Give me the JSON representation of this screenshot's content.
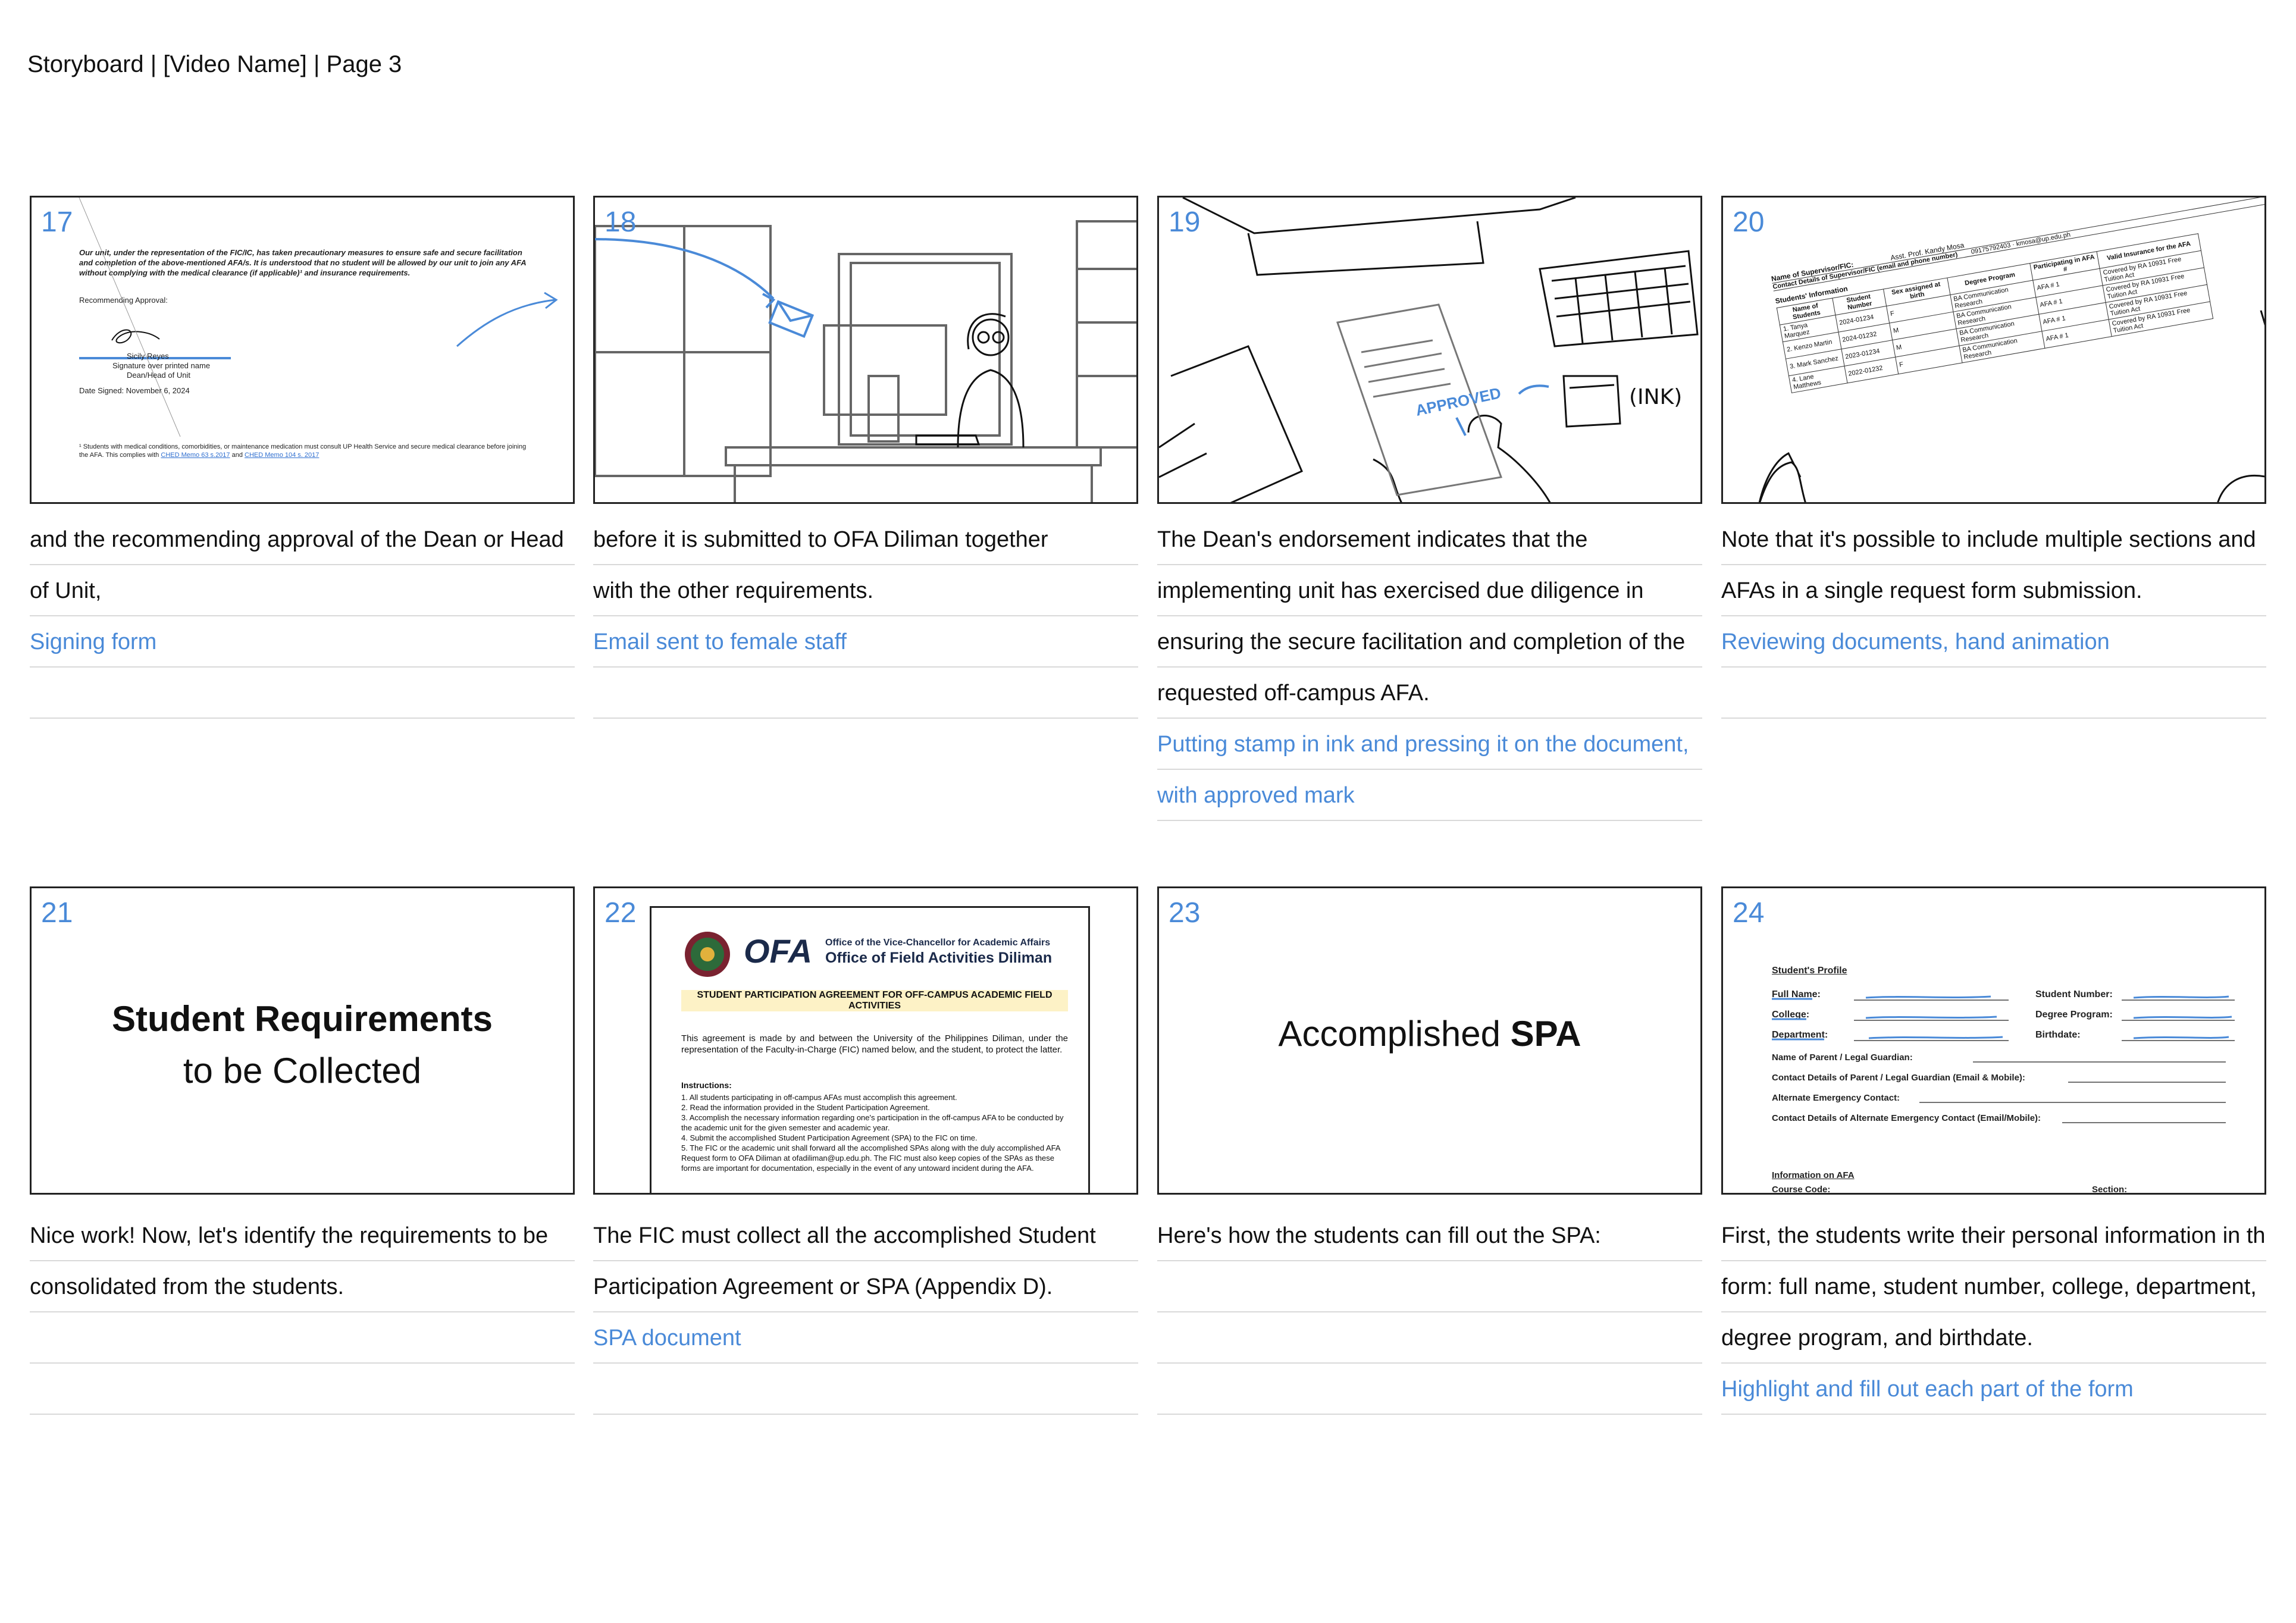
{
  "header": {
    "title": "Storyboard | [Video Name] | Page 3"
  },
  "colors": {
    "accent": "#4a8ad8",
    "border": "#222222",
    "rule": "#d9d9d9",
    "highlight": "#fdf2c6"
  },
  "frames": [
    {
      "number": "17",
      "doc": {
        "paragraph": "Our unit, under the representation of the FIC/IC, has taken precautionary measures to ensure safe and secure facilitation and completion of the above-mentioned AFA/s. It is understood that no student will be allowed by our unit to join any AFA without complying with the medical clearance (if applicable)¹ and insurance requirements.",
        "recommending": "Recommending Approval:",
        "signer_name": "Sicily Reyes",
        "signer_caption": "Signature over printed name",
        "signer_role": "Dean/Head of Unit",
        "date_signed": "Date Signed: November 6, 2024",
        "footnote": "¹ Students with medical conditions, comorbidities, or maintenance medication must consult UP Health Service and secure medical clearance before joining the AFA. This complies with",
        "link_1": "CHED Memo 63 s.2017",
        "link_join": "and",
        "link_2": "CHED Memo 104 s. 2017"
      },
      "notes": [
        "and the recommending approval of the Dean or Head",
        "of Unit,"
      ],
      "action": [
        "Signing form"
      ]
    },
    {
      "number": "18",
      "notes": [
        "before it is submitted to OFA Diliman together",
        "with the other requirements."
      ],
      "action": [
        "Email sent to female staff"
      ]
    },
    {
      "number": "19",
      "stamp_text": "APPROVED",
      "ink_label": "(INK)",
      "notes": [
        "The Dean's endorsement indicates that the",
        "implementing unit has exercised due diligence in",
        "ensuring the secure facilitation and completion of the",
        "requested off-campus AFA."
      ],
      "action": [
        "Putting stamp in ink and pressing it on the document,",
        "with approved mark"
      ]
    },
    {
      "number": "20",
      "table": {
        "supervisor_label": "Name of Supervisor/FIC:",
        "supervisor_value": "Asst. Prof. Kandy Mosa",
        "contact_label": "Contact Details of Supervisor/FIC (email and phone number)",
        "contact_value": "09175792403 · kmosa@up.edu.ph",
        "section_label": "Students' Information",
        "headers": [
          "Name of Students",
          "Student Number",
          "Sex assigned at birth",
          "Degree Program",
          "Participating in AFA #",
          "Valid Insurance for the AFA"
        ],
        "rows": [
          [
            "1. Tanya Marquez",
            "2024-01234",
            "F",
            "BA Communication Research",
            "AFA # 1",
            "Covered by RA 10931 Free Tuition Act"
          ],
          [
            "2. Kenzo Martin",
            "2024-01232",
            "M",
            "BA Communication Research",
            "AFA # 1",
            "Covered by RA 10931 Free Tuition Act"
          ],
          [
            "3. Mark Sanchez",
            "2023-01234",
            "M",
            "BA Communication Research",
            "AFA # 1",
            "Covered by RA 10931 Free Tuition Act"
          ],
          [
            "4. Lane Matthews",
            "2022-01232",
            "F",
            "BA Communication Research",
            "AFA # 1",
            "Covered by RA 10931 Free Tuition Act"
          ]
        ]
      },
      "notes": [
        "Note that it's possible to include multiple sections and",
        "AFAs in a single request form submission."
      ],
      "action": [
        "Reviewing documents, hand animation"
      ]
    },
    {
      "number": "21",
      "title_bold": "Student Requirements",
      "title_light": "to be Collected",
      "notes": [
        "Nice work! Now, let's identify the requirements to be",
        "consolidated from the students."
      ],
      "action": []
    },
    {
      "number": "22",
      "doc": {
        "org_line1": "Office of the Vice-Chancellor for Academic Affairs",
        "org_line2": "Office of Field Activities Diliman",
        "logo_text": "OFA",
        "title": "STUDENT PARTICIPATION AGREEMENT FOR OFF-CAMPUS ACADEMIC FIELD ACTIVITIES",
        "intro": "This agreement is made by and between the University of the Philippines Diliman, under the representation of the Faculty-in-Charge (FIC) named below, and the student, to protect the latter.",
        "instructions_label": "Instructions:",
        "instructions": [
          "1.  All students participating in off-campus AFAs must accomplish this agreement.",
          "2.  Read the information provided in the Student Participation Agreement.",
          "3.  Accomplish the necessary information regarding one's participation in the off-campus AFA to be conducted by the academic unit for the given semester and academic year.",
          "4.  Submit the accomplished Student Participation Agreement (SPA) to the FIC on time.",
          "5.  The FIC or the academic unit shall forward all the accomplished SPAs along with the duly accomplished AFA Request form to OFA Diliman at ofadiliman@up.edu.ph. The FIC must also keep copies of the SPAs as these forms are important for documentation, especially in the event of any untoward incident during the AFA."
        ]
      },
      "notes": [
        "The FIC must collect all the accomplished Student",
        "Participation Agreement or SPA (Appendix D)."
      ],
      "action": [
        "SPA document"
      ]
    },
    {
      "number": "23",
      "title_light": "Accomplished",
      "title_bold": "SPA",
      "notes": [
        "Here's how the students can fill out the SPA:"
      ],
      "action": []
    },
    {
      "number": "24",
      "form": {
        "section_title": "Student's Profile",
        "full_name": "Full Name:",
        "college": "College:",
        "department": "Department:",
        "student_number": "Student Number:",
        "degree_program": "Degree Program:",
        "birthdate": "Birthdate:",
        "parent": "Name of Parent / Legal Guardian:",
        "parent_contact": "Contact Details of Parent / Legal Guardian (Email & Mobile):",
        "alt_contact": "Alternate Emergency Contact:",
        "alt_contact_details": "Contact Details of Alternate Emergency Contact (Email/Mobile):",
        "afa_title": "Information on AFA",
        "course_code": "Course Code:",
        "section": "Section:"
      },
      "notes": [
        "First, the students write their personal information in the",
        "form: full name, student number, college, department,",
        "degree program, and birthdate."
      ],
      "action": [
        "Highlight and fill out each part of the form"
      ]
    }
  ]
}
